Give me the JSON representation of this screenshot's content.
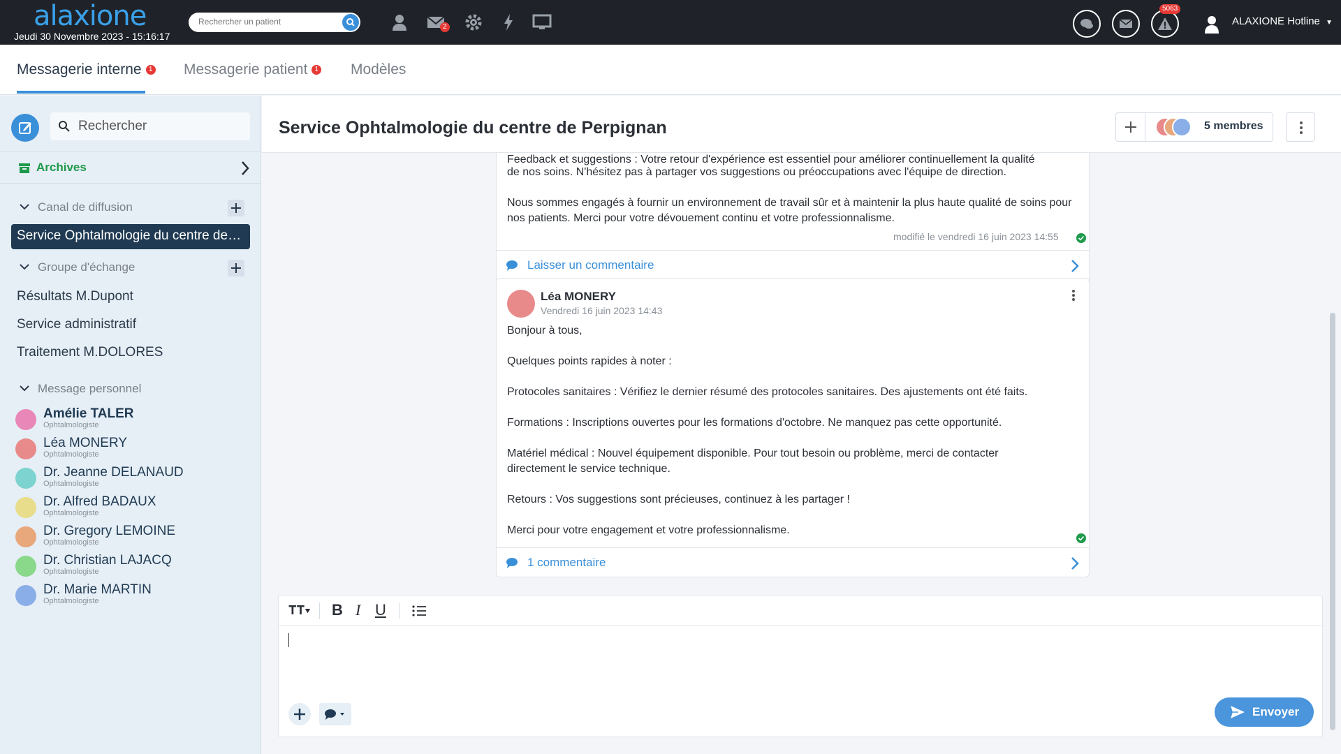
{
  "topbar": {
    "logo": "alaxione",
    "datetime": "Jeudi 30 Novembre 2023 - 15:16:17",
    "search_placeholder": "Rechercher un patient",
    "mail_badge": "2",
    "alert_badge": "5063",
    "user_name": "ALAXIONE Hotline"
  },
  "tabs": [
    {
      "label": "Messagerie interne",
      "badge": "1"
    },
    {
      "label": "Messagerie patient",
      "badge": "1"
    },
    {
      "label": "Modèles"
    }
  ],
  "sidebar": {
    "search_placeholder": "Rechercher",
    "archives": "Archives",
    "broadcast_header": "Canal de diffusion",
    "active_channel": "Service Ophtalmologie du centre de Perpignan",
    "exchange_header": "Groupe d'échange",
    "groups": [
      "Résultats M.Dupont",
      "Service administratif",
      "Traitement M.DOLORES"
    ],
    "personal_header": "Message personnel",
    "contacts": [
      {
        "name": "Amélie TALER",
        "role": "Ophtalmologiste",
        "color": "#e887b8"
      },
      {
        "name": "Léa MONERY",
        "role": "Ophtalmologiste",
        "color": "#e88a8a"
      },
      {
        "name": "Dr. Jeanne DELANAUD",
        "role": "Ophtalmologiste",
        "color": "#7dd3d0"
      },
      {
        "name": "Dr. Alfred BADAUX",
        "role": "Ophtalmologiste",
        "color": "#e8dd8a"
      },
      {
        "name": "Dr. Gregory LEMOINE",
        "role": "Ophtalmologiste",
        "color": "#e8a87c"
      },
      {
        "name": "Dr. Christian LAJACQ",
        "role": "Ophtalmologiste",
        "color": "#8ad88a"
      },
      {
        "name": "Dr. Marie MARTIN",
        "role": "Ophtalmologiste",
        "color": "#8aaee8"
      }
    ]
  },
  "main": {
    "title": "Service Ophtalmologie du centre de Perpignan",
    "members": "5 membres",
    "post1": {
      "partial_line": "Feedback et suggestions : Votre retour d'expérience est essentiel pour améliorer continuellement la qualité",
      "line2": "de nos soins. N'hésitez pas à partager vos suggestions ou préoccupations avec l'équipe de direction.",
      "para2": "Nous sommes engagés à fournir un environnement de travail sûr et à maintenir la plus haute qualité de soins pour nos patients. Merci pour votre dévouement continu et votre professionnalisme.",
      "modified": "modifié le vendredi 16 juin 2023 14:55",
      "footer": "Laisser un commentaire"
    },
    "post2": {
      "author": "Léa MONERY",
      "date": "Vendredi 16 juin 2023 14:43",
      "paragraphs": [
        "Bonjour à tous,",
        "Quelques points rapides à noter :",
        "Protocoles sanitaires : Vérifiez le dernier résumé des protocoles sanitaires. Des ajustements ont été faits.",
        "Formations : Inscriptions ouvertes pour les formations d'octobre. Ne manquez pas cette opportunité.",
        "Matériel médical : Nouvel équipement disponible. Pour tout besoin ou problème, merci de contacter directement le service technique.",
        "Retours : Vos suggestions sont précieuses, continuez à les partager !",
        "Merci pour votre engagement et votre professionnalisme."
      ],
      "footer": "1 commentaire"
    }
  },
  "composer": {
    "send_label": "Envoyer"
  },
  "colors": {
    "accent": "#3a8fd9",
    "topbar": "#1f2329",
    "success": "#1e9a4a"
  }
}
